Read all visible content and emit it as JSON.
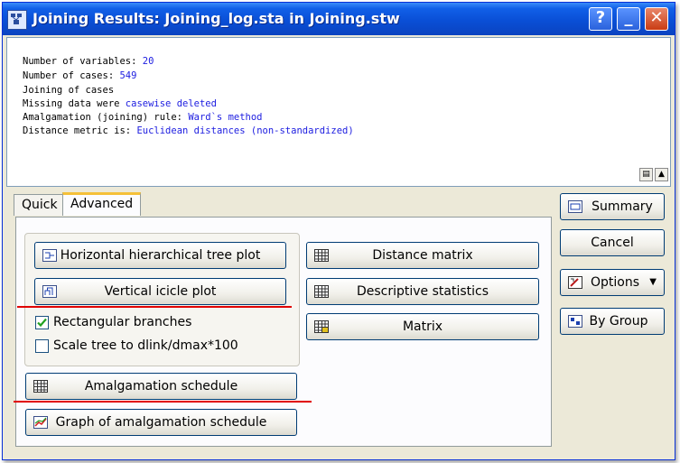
{
  "window": {
    "title": "Joining Results: Joining_log.sta in Joining.stw",
    "help_label": "?",
    "minimize_label": "_",
    "close_label": "✕"
  },
  "summary_text": [
    {
      "label": "Number of variables: ",
      "value": "20"
    },
    {
      "label": "Number of cases: ",
      "value": "549"
    },
    {
      "label": "Joining of cases",
      "value": ""
    },
    {
      "label": "Missing data were ",
      "value": "casewise deleted"
    },
    {
      "label": "Amalgamation (joining) rule: ",
      "value": "Ward`s method"
    },
    {
      "label": "Distance metric is: ",
      "value": "Euclidean distances (non-standardized)"
    }
  ],
  "tabs": {
    "quick": "Quick",
    "advanced": "Advanced"
  },
  "left_buttons": {
    "horizontal_tree": "Horizontal hierarchical tree plot",
    "vertical_icicle": "Vertical icicle plot",
    "amalgamation_schedule": "Amalgamation schedule",
    "graph_amalgamation": "Graph of amalgamation schedule"
  },
  "checkboxes": {
    "rectangular_branches": {
      "label": "Rectangular branches",
      "checked": true
    },
    "scale_tree": {
      "label": "Scale tree to dlink/dmax*100",
      "checked": false
    }
  },
  "middle_buttons": {
    "distance_matrix": "Distance matrix",
    "descriptive_statistics": "Descriptive statistics",
    "matrix": "Matrix"
  },
  "right_buttons": {
    "summary": "Summary",
    "cancel": "Cancel",
    "options": "Options",
    "by_group": "By Group"
  },
  "colors": {
    "title_bar": "#0a4fd6",
    "value_text": "#1c1ce0",
    "highlight_underline": "#e00000",
    "tab_accent": "#f5c038"
  }
}
